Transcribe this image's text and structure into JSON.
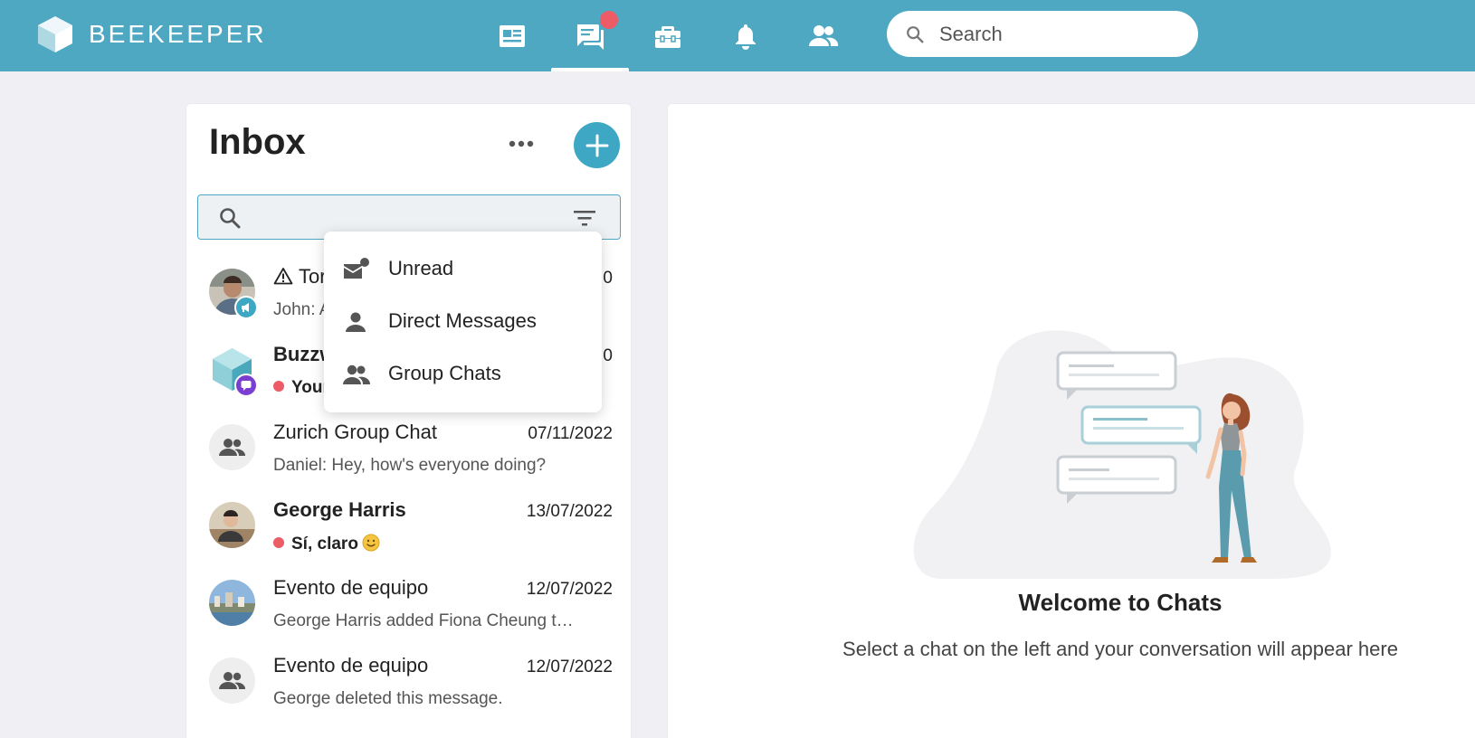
{
  "header": {
    "brand_name": "BEEKEEPER",
    "brand_color": "#4ea8c2",
    "nav": [
      {
        "name": "news-feed",
        "icon": "newspaper-icon"
      },
      {
        "name": "chats",
        "icon": "chat-icon",
        "active": true,
        "has_badge": true
      },
      {
        "name": "tools",
        "icon": "toolbox-icon"
      },
      {
        "name": "notifications",
        "icon": "bell-icon"
      },
      {
        "name": "people",
        "icon": "people-icon"
      }
    ],
    "search_placeholder": "Search"
  },
  "inbox": {
    "title": "Inbox",
    "more_icon": "more-horizontal-icon",
    "add_icon": "plus-icon",
    "search_value": "",
    "filter_icon": "filter-icon",
    "chats": [
      {
        "name": "Tor",
        "has_warning": true,
        "date": "0",
        "preview": "John: A",
        "bold": false,
        "unread": false,
        "avatar": "photo",
        "badge": "megaphone-icon"
      },
      {
        "name": "Buzzw",
        "has_warning": false,
        "date": "0",
        "preview": "Your",
        "bold": true,
        "unread": true,
        "avatar": "logo",
        "badge": "chat-bubble-icon"
      },
      {
        "name": "Zurich Group Chat",
        "has_warning": false,
        "date": "07/11/2022",
        "preview": "Daniel: Hey, how's everyone doing?",
        "bold": false,
        "unread": false,
        "avatar": "group"
      },
      {
        "name": "George Harris",
        "has_warning": false,
        "date": "13/07/2022",
        "preview": "Sí, claro",
        "bold": true,
        "unread": true,
        "avatar": "photo",
        "emoji": "smiley-icon"
      },
      {
        "name": "Evento de equipo",
        "has_warning": false,
        "date": "12/07/2022",
        "preview": "George Harris added Fiona Cheung t…",
        "bold": false,
        "unread": false,
        "avatar": "photo"
      },
      {
        "name": "Evento de equipo",
        "has_warning": false,
        "date": "12/07/2022",
        "preview": "George deleted this message.",
        "bold": false,
        "unread": false,
        "avatar": "group"
      }
    ]
  },
  "filter_menu": {
    "items": [
      {
        "label": "Unread",
        "icon": "unread-mail-icon"
      },
      {
        "label": "Direct Messages",
        "icon": "person-icon"
      },
      {
        "label": "Group Chats",
        "icon": "group-icon"
      }
    ]
  },
  "welcome": {
    "title": "Welcome to Chats",
    "subtitle": "Select a chat on the left and your conversation will appear here"
  },
  "colors": {
    "accent": "#3ea8c4",
    "unread_dot": "#ec5b66",
    "badge_megaphone": "#3ea8c4",
    "badge_chat": "#7a3fd0"
  }
}
